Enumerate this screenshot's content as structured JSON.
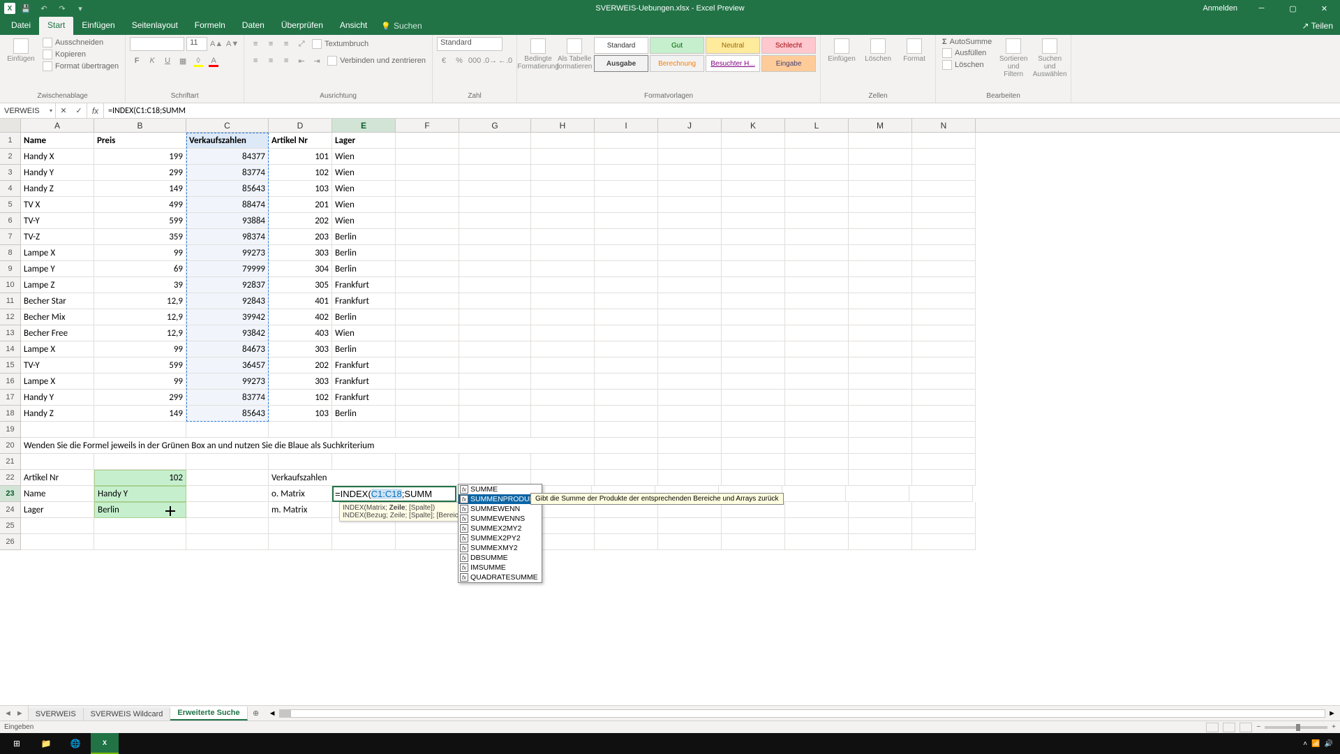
{
  "window": {
    "title": "SVERWEIS-Uebungen.xlsx - Excel Preview",
    "signin": "Anmelden",
    "share": "Teilen"
  },
  "tabs": {
    "file": "Datei",
    "home": "Start",
    "insert": "Einfügen",
    "layout": "Seitenlayout",
    "formulas": "Formeln",
    "data": "Daten",
    "review": "Überprüfen",
    "view": "Ansicht",
    "tellme": "Suchen"
  },
  "ribbon": {
    "clipboard": {
      "label": "Zwischenablage",
      "paste": "Einfügen",
      "cut": "Ausschneiden",
      "copy": "Kopieren",
      "format": "Format übertragen"
    },
    "font": {
      "label": "Schriftart",
      "size": "11"
    },
    "alignment": {
      "label": "Ausrichtung",
      "wrap": "Textumbruch",
      "merge": "Verbinden und zentrieren"
    },
    "number": {
      "label": "Zahl",
      "format": "Standard"
    },
    "styles": {
      "label": "Formatvorlagen",
      "cond": "Bedingte Formatierung",
      "astable": "Als Tabelle formatieren",
      "cells": [
        "Standard",
        "Gut",
        "Neutral",
        "Schlecht",
        "Ausgabe",
        "Berechnung",
        "Besuchter H...",
        "Eingabe"
      ]
    },
    "cells_group": {
      "label": "Zellen",
      "insert": "Einfügen",
      "delete": "Löschen",
      "format": "Format"
    },
    "editing": {
      "label": "Bearbeiten",
      "autosum": "AutoSumme",
      "fill": "Ausfüllen",
      "clear": "Löschen",
      "sort": "Sortieren und Filtern",
      "find": "Suchen und Auswählen"
    }
  },
  "namebox": "VERWEIS",
  "formula": "=INDEX(C1:C18;SUMM",
  "columns": [
    "A",
    "B",
    "C",
    "D",
    "E",
    "F",
    "G",
    "H",
    "I",
    "J",
    "K",
    "L",
    "M",
    "N"
  ],
  "rows": [
    {
      "n": 1,
      "A": "Name",
      "B": "Preis",
      "C": "Verkaufszahlen",
      "D": "Artikel Nr",
      "E": "Lager",
      "bold": true,
      "cHeader": true
    },
    {
      "n": 2,
      "A": "Handy X",
      "B": "199",
      "C": "84377",
      "D": "101",
      "E": "Wien"
    },
    {
      "n": 3,
      "A": "Handy Y",
      "B": "299",
      "C": "83774",
      "D": "102",
      "E": "Wien"
    },
    {
      "n": 4,
      "A": "Handy Z",
      "B": "149",
      "C": "85643",
      "D": "103",
      "E": "Wien"
    },
    {
      "n": 5,
      "A": "TV X",
      "B": "499",
      "C": "88474",
      "D": "201",
      "E": "Wien"
    },
    {
      "n": 6,
      "A": "TV-Y",
      "B": "599",
      "C": "93884",
      "D": "202",
      "E": "Wien"
    },
    {
      "n": 7,
      "A": "TV-Z",
      "B": "359",
      "C": "98374",
      "D": "203",
      "E": "Berlin"
    },
    {
      "n": 8,
      "A": "Lampe X",
      "B": "99",
      "C": "99273",
      "D": "303",
      "E": "Berlin"
    },
    {
      "n": 9,
      "A": "Lampe Y",
      "B": "69",
      "C": "79999",
      "D": "304",
      "E": "Berlin"
    },
    {
      "n": 10,
      "A": "Lampe Z",
      "B": "39",
      "C": "92837",
      "D": "305",
      "E": "Frankfurt"
    },
    {
      "n": 11,
      "A": "Becher Star",
      "B": "12,9",
      "C": "92843",
      "D": "401",
      "E": "Frankfurt"
    },
    {
      "n": 12,
      "A": "Becher Mix",
      "B": "12,9",
      "C": "39942",
      "D": "402",
      "E": "Berlin"
    },
    {
      "n": 13,
      "A": "Becher Free",
      "B": "12,9",
      "C": "93842",
      "D": "403",
      "E": "Wien"
    },
    {
      "n": 14,
      "A": "Lampe X",
      "B": "99",
      "C": "84673",
      "D": "303",
      "E": "Berlin"
    },
    {
      "n": 15,
      "A": "TV-Y",
      "B": "599",
      "C": "36457",
      "D": "202",
      "E": "Frankfurt"
    },
    {
      "n": 16,
      "A": "Lampe X",
      "B": "99",
      "C": "99273",
      "D": "303",
      "E": "Frankfurt"
    },
    {
      "n": 17,
      "A": "Handy Y",
      "B": "299",
      "C": "83774",
      "D": "102",
      "E": "Frankfurt"
    },
    {
      "n": 18,
      "A": "Handy Z",
      "B": "149",
      "C": "85643",
      "D": "103",
      "E": "Berlin"
    },
    {
      "n": 19
    },
    {
      "n": 20,
      "A": "Wenden Sie die Formel jeweils in der Grünen Box an und nutzen Sie die Blaue als Suchkriterium",
      "span": 9
    },
    {
      "n": 21
    },
    {
      "n": 22,
      "A": "Artikel Nr",
      "B": "102",
      "D": "Verkaufszahlen",
      "greenB": true,
      "Dspan": 2
    },
    {
      "n": 23,
      "A": "Name",
      "B": "Handy Y",
      "D": "o. Matrix",
      "Eformula": true,
      "greenB": true,
      "selrow": true
    },
    {
      "n": 24,
      "A": "Lager",
      "B": "Berlin",
      "D": "m. Matrix",
      "greenB": true
    },
    {
      "n": 25
    },
    {
      "n": 26
    }
  ],
  "cell_formula": {
    "prefix": "=INDEX(",
    "ref": "C1:C18",
    "mid": ";SUMM"
  },
  "syntax_tip": {
    "l1": "INDEX(Matrix; Zeile; [Spalte])",
    "l2": "INDEX(Bezug; Zeile; [Spalte]; [Bereich])",
    "bold": "Zeile"
  },
  "ac": {
    "items": [
      "SUMME",
      "SUMMENPRODUKT",
      "SUMMEWENN",
      "SUMMEWENNS",
      "SUMMEX2MY2",
      "SUMMEX2PY2",
      "SUMMEXMY2",
      "DBSUMME",
      "IMSUMME",
      "QUADRATESUMME"
    ],
    "selected": 1,
    "desc": "Gibt die Summe der Produkte der entsprechenden Bereiche und Arrays zurück"
  },
  "sheets": {
    "items": [
      "SVERWEIS",
      "SVERWEIS Wildcard",
      "Erweiterte Suche"
    ],
    "active": 2
  },
  "status": {
    "mode": "Eingeben"
  }
}
